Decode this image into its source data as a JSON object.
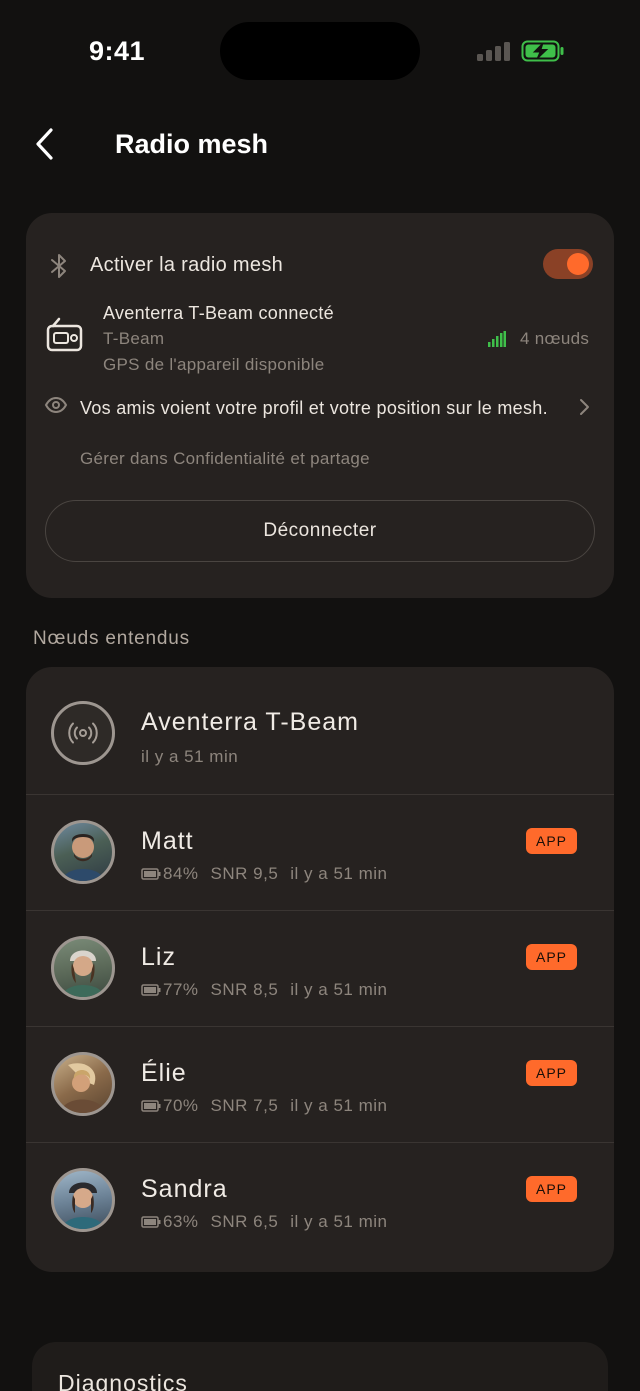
{
  "status_bar": {
    "time": "9:41"
  },
  "header": {
    "title": "Radio mesh"
  },
  "mesh": {
    "toggle_label": "Activer la radio mesh",
    "toggle_on": true,
    "device_name": "Aventerra T-Beam connecté",
    "device_model": "T-Beam",
    "device_gps": "GPS de l'appareil disponible",
    "node_count": "4 nœuds",
    "privacy_text": "Vos amis voient votre profil et votre position sur le mesh.",
    "privacy_manage": "Gérer dans Confidentialité et partage",
    "disconnect_label": "Déconnecter"
  },
  "nodes_section": {
    "title": "Nœuds entendus",
    "self_node": {
      "name": "Aventerra T-Beam",
      "time": "il y a 51 min"
    },
    "nodes": [
      {
        "name": "Matt",
        "battery": "84%",
        "snr": "SNR 9,5",
        "time": "il y a 51 min",
        "badge": "APP"
      },
      {
        "name": "Liz",
        "battery": "77%",
        "snr": "SNR 8,5",
        "time": "il y a 51 min",
        "badge": "APP"
      },
      {
        "name": "Élie",
        "battery": "70%",
        "snr": "SNR 7,5",
        "time": "il y a 51 min",
        "badge": "APP"
      },
      {
        "name": "Sandra",
        "battery": "63%",
        "snr": "SNR 6,5",
        "time": "il y a 51 min",
        "badge": "APP"
      }
    ]
  },
  "diagnostics": {
    "title": "Diagnostics"
  },
  "colors": {
    "accent": "#ff6a2b",
    "background": "#121110",
    "card": "#262220",
    "signal_green": "#3fbf4a"
  }
}
